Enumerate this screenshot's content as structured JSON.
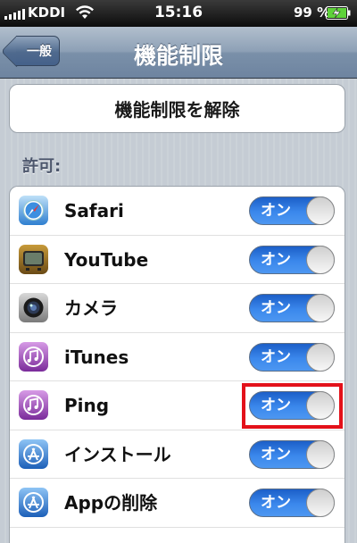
{
  "status_bar": {
    "carrier": "KDDI",
    "time": "15:16",
    "battery_pct": "99 %"
  },
  "nav": {
    "back_label": "一般",
    "title": "機能制限"
  },
  "unlock_button_label": "機能制限を解除",
  "section_label": "許可:",
  "rows": [
    {
      "label": "Safari",
      "icon": "safari-icon",
      "toggle": "オン",
      "on": true
    },
    {
      "label": "YouTube",
      "icon": "youtube-icon",
      "toggle": "オン",
      "on": true
    },
    {
      "label": "カメラ",
      "icon": "camera-icon",
      "toggle": "オン",
      "on": true
    },
    {
      "label": "iTunes",
      "icon": "itunes-icon",
      "toggle": "オン",
      "on": true
    },
    {
      "label": "Ping",
      "icon": "ping-icon",
      "toggle": "オン",
      "on": true
    },
    {
      "label": "インストール",
      "icon": "app-store-icon",
      "toggle": "オン",
      "on": true
    },
    {
      "label": "Appの削除",
      "icon": "app-store-icon",
      "toggle": "オン",
      "on": true
    }
  ],
  "colors": {
    "highlight": "#e3111a",
    "toggle_on": "#3b88ec"
  }
}
